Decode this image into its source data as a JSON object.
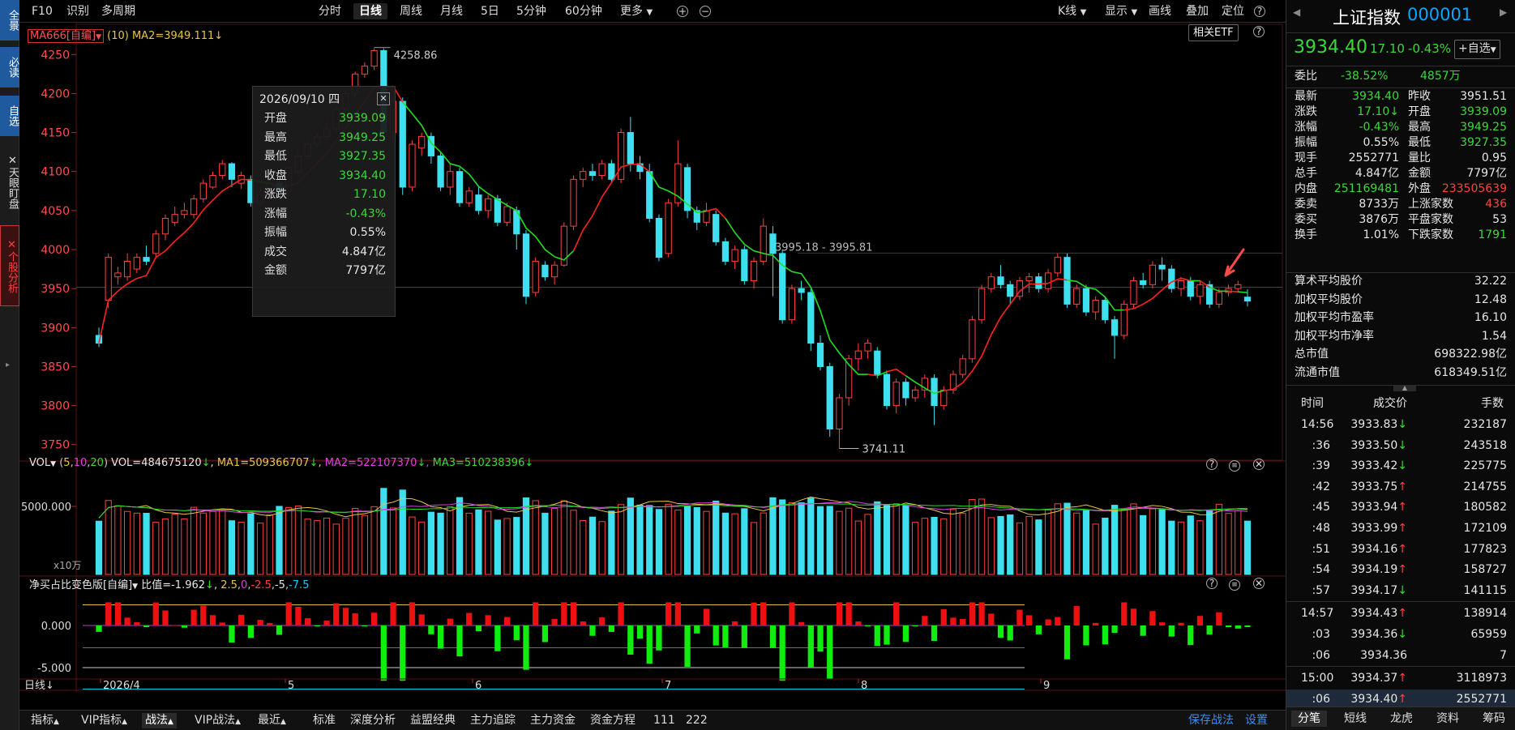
{
  "leftbar": {
    "items": [
      {
        "label": "全景",
        "style": "blue"
      },
      {
        "label": "必读",
        "style": "blue"
      },
      {
        "label": "自选",
        "style": "blue"
      },
      {
        "label": "天眼盯盘",
        "style": "plain"
      },
      {
        "label": "个股分析",
        "style": "red"
      }
    ]
  },
  "toolbar": {
    "left": [
      "F10",
      "识别",
      "多周期"
    ],
    "periods": [
      "分时",
      "日线",
      "周线",
      "月线",
      "5日",
      "5分钟",
      "60分钟",
      "更多"
    ],
    "active_period": "日线",
    "right": [
      "K线",
      "显示",
      "画线",
      "叠加",
      "定位"
    ],
    "etf_button": "相关ETF"
  },
  "indicator_main": {
    "name": "MA666[自编]",
    "param": "(10)",
    "ma2": "MA2=3949.111"
  },
  "price_axis": [
    "4250",
    "4200",
    "4150",
    "4100",
    "4050",
    "4000",
    "3950",
    "3900",
    "3850",
    "3800",
    "3750"
  ],
  "annotations": {
    "high": "4258.86",
    "low": "3741.11",
    "range": "3995.18 - 3995.81"
  },
  "tooltip": {
    "date": "2026/09/10 四",
    "rows": [
      {
        "k": "开盘",
        "v": "3939.09",
        "c": "green"
      },
      {
        "k": "最高",
        "v": "3949.25",
        "c": "green"
      },
      {
        "k": "最低",
        "v": "3927.35",
        "c": "green"
      },
      {
        "k": "收盘",
        "v": "3934.40",
        "c": "green"
      },
      {
        "k": "涨跌",
        "v": "17.10",
        "c": "green"
      },
      {
        "k": "涨幅",
        "v": "-0.43%",
        "c": "green"
      },
      {
        "k": "振幅",
        "v": "0.55%",
        "c": "white"
      },
      {
        "k": "成交",
        "v": "4.847亿",
        "c": "white"
      },
      {
        "k": "金额",
        "v": "7797亿",
        "c": "white"
      }
    ]
  },
  "vol_panel": {
    "label": "VOL",
    "params": "(5,10,20)",
    "vol": "VOL=484675120",
    "ma1": "MA1=509366707",
    "ma2": "MA2=522107370",
    "ma3": "MA3=510238396",
    "axis": "5000.000",
    "unit": "x10万"
  },
  "net_panel": {
    "label": "净买占比变色版[自编]",
    "ratio": "比值=-1.962",
    "levels": [
      "2.5",
      "0",
      "-2.5",
      "-5",
      "-7.5"
    ],
    "axis": [
      "0.000",
      "-5.000"
    ]
  },
  "date_axis": {
    "label": "日线",
    "labels": [
      "2026/4",
      "5",
      "6",
      "7",
      "8",
      "9"
    ]
  },
  "bottombar": {
    "items": [
      "指标",
      "VIP指标",
      "战法",
      "VIP战法",
      "最近",
      "标准",
      "深度分析",
      "益盟经典",
      "主力追踪",
      "主力资金",
      "资金方程",
      "111",
      "222"
    ],
    "active": "战法",
    "save": "保存战法",
    "settings": "设置"
  },
  "quote": {
    "name": "上证指数",
    "code": "000001",
    "price": "3934.40",
    "change": "17.10",
    "pct": "-0.43%",
    "add_button": "+自选",
    "weibi_label": "委比",
    "weibi": "-38.52%",
    "weicha": "4857万",
    "stats": [
      [
        "最新",
        "3934.40",
        "green",
        "昨收",
        "3951.51",
        "white"
      ],
      [
        "涨跌",
        "17.10↓",
        "green",
        "开盘",
        "3939.09",
        "green"
      ],
      [
        "涨幅",
        "-0.43%",
        "green",
        "最高",
        "3949.25",
        "green"
      ],
      [
        "振幅",
        "0.55%",
        "white",
        "最低",
        "3927.35",
        "green"
      ],
      [
        "现手",
        "2552771",
        "white",
        "量比",
        "0.95",
        "white"
      ],
      [
        "总手",
        "4.847亿",
        "white",
        "金额",
        "7797亿",
        "white"
      ],
      [
        "内盘",
        "251169481",
        "green",
        "外盘",
        "233505639",
        "red"
      ],
      [
        "委卖",
        "8733万",
        "white",
        "上涨家数",
        "436",
        "red"
      ],
      [
        "委买",
        "3876万",
        "white",
        "平盘家数",
        "53",
        "white"
      ],
      [
        "换手",
        "1.01%",
        "white",
        "下跌家数",
        "1791",
        "green"
      ]
    ],
    "avg": [
      [
        "算术平均股价",
        "32.22"
      ],
      [
        "加权平均股价",
        "12.48"
      ],
      [
        "加权平均市盈率",
        "16.10"
      ],
      [
        "加权平均市净率",
        "1.54"
      ],
      [
        "总市值",
        "698322.98亿"
      ],
      [
        "流通市值",
        "618349.51亿"
      ]
    ]
  },
  "ticks": {
    "headers": [
      "时间",
      "成交价",
      "手数"
    ],
    "rows": [
      [
        "14:56",
        "3933.83↓",
        "232187",
        "green"
      ],
      [
        ":36",
        "3933.50↓",
        "243518",
        "green"
      ],
      [
        ":39",
        "3933.42↓",
        "225775",
        "green"
      ],
      [
        ":42",
        "3933.75↑",
        "214755",
        "red"
      ],
      [
        ":45",
        "3933.94↑",
        "180582",
        "red"
      ],
      [
        ":48",
        "3933.99↑",
        "172109",
        "red"
      ],
      [
        ":51",
        "3934.16↑",
        "177823",
        "red"
      ],
      [
        ":54",
        "3934.19↑",
        "158727",
        "red"
      ],
      [
        ":57",
        "3934.17↓",
        "141115",
        "green"
      ],
      [
        "14:57",
        "3934.43↑",
        "138914",
        "red"
      ],
      [
        ":03",
        "3934.36↓",
        "65959",
        "green"
      ],
      [
        ":06",
        "3934.36",
        "7",
        "white"
      ],
      [
        "15:00",
        "3934.37↑",
        "3118973",
        "red"
      ],
      [
        ":06",
        "3934.40↑",
        "2552771",
        "red"
      ]
    ]
  },
  "rtabs": [
    "分笔",
    "短线",
    "龙虎",
    "资料",
    "筹码"
  ],
  "rtab_active": "分笔",
  "colors": {
    "up": "#ff4040",
    "down": "#3ee0f0",
    "ma_red": "#ff2020",
    "ma_green": "#22dd22"
  },
  "chart_data": {
    "type": "candlestick",
    "price_range": [
      3730,
      4270
    ],
    "dates": [
      "2026/4",
      "5",
      "6",
      "7",
      "8",
      "9"
    ],
    "candles": [
      [
        3890,
        3880,
        3900,
        3875
      ],
      [
        3935,
        3990,
        3995,
        3925
      ],
      [
        3965,
        3970,
        3978,
        3955
      ],
      [
        3965,
        3985,
        3995,
        3960
      ],
      [
        3975,
        3990,
        3995,
        3970
      ],
      [
        3990,
        3985,
        4005,
        3980
      ],
      [
        3995,
        4020,
        4025,
        3990
      ],
      [
        4020,
        4040,
        4045,
        4012
      ],
      [
        4035,
        4045,
        4055,
        4030
      ],
      [
        4045,
        4050,
        4060,
        4040
      ],
      [
        4045,
        4065,
        4070,
        4040
      ],
      [
        4065,
        4085,
        4090,
        4060
      ],
      [
        4080,
        4095,
        4100,
        4078
      ],
      [
        4095,
        4110,
        4115,
        4090
      ],
      [
        4110,
        4090,
        4112,
        4080
      ],
      [
        4085,
        4095,
        4100,
        4078
      ],
      [
        4090,
        4060,
        4095,
        4055
      ],
      [
        4060,
        4070,
        4080,
        4055
      ],
      [
        4070,
        4085,
        4090,
        4068
      ],
      [
        4085,
        4075,
        4090,
        4070
      ],
      [
        4075,
        4105,
        4108,
        4070
      ],
      [
        4100,
        4120,
        4125,
        4095
      ],
      [
        4120,
        4135,
        4140,
        4115
      ],
      [
        4135,
        4145,
        4150,
        4130
      ],
      [
        4145,
        4155,
        4165,
        4140
      ],
      [
        4155,
        4180,
        4185,
        4150
      ],
      [
        4180,
        4200,
        4205,
        4175
      ],
      [
        4200,
        4225,
        4228,
        4195
      ],
      [
        4225,
        4235,
        4240,
        4220
      ],
      [
        4235,
        4255,
        4258,
        4230
      ],
      [
        4255,
        4150,
        4258,
        4140
      ],
      [
        4150,
        4190,
        4195,
        4140
      ],
      [
        4190,
        4080,
        4195,
        4070
      ],
      [
        4080,
        4135,
        4140,
        4075
      ],
      [
        4130,
        4145,
        4150,
        4120
      ],
      [
        4145,
        4120,
        4150,
        4110
      ],
      [
        4120,
        4080,
        4125,
        4075
      ],
      [
        4080,
        4100,
        4110,
        4070
      ],
      [
        4100,
        4060,
        4105,
        4055
      ],
      [
        4060,
        4075,
        4080,
        4055
      ],
      [
        4070,
        4050,
        4080,
        4045
      ],
      [
        4050,
        4065,
        4070,
        4040
      ],
      [
        4065,
        4035,
        4070,
        4030
      ],
      [
        4035,
        4055,
        4060,
        4030
      ],
      [
        4050,
        4020,
        4055,
        4000
      ],
      [
        4020,
        3940,
        4025,
        3930
      ],
      [
        3945,
        3985,
        3990,
        3940
      ],
      [
        3980,
        3965,
        3985,
        3960
      ],
      [
        3965,
        3980,
        3985,
        3955
      ],
      [
        3980,
        4030,
        4035,
        3978
      ],
      [
        4030,
        4090,
        4095,
        4025
      ],
      [
        4090,
        4100,
        4105,
        4080
      ],
      [
        4100,
        4095,
        4110,
        4088
      ],
      [
        4095,
        4110,
        4115,
        4090
      ],
      [
        4110,
        4090,
        4115,
        4085
      ],
      [
        4090,
        4150,
        4155,
        4085
      ],
      [
        4150,
        4110,
        4170,
        4100
      ],
      [
        4110,
        4100,
        4120,
        4090
      ],
      [
        4100,
        4040,
        4110,
        4035
      ],
      [
        4040,
        3990,
        4045,
        3985
      ],
      [
        3995,
        4060,
        4065,
        3990
      ],
      [
        4060,
        4110,
        4140,
        4055
      ],
      [
        4105,
        4050,
        4110,
        4040
      ],
      [
        4050,
        4035,
        4055,
        4025
      ],
      [
        4035,
        4050,
        4060,
        4030
      ],
      [
        4045,
        4010,
        4050,
        4005
      ],
      [
        4010,
        3985,
        4015,
        3980
      ],
      [
        3985,
        4000,
        4005,
        3975
      ],
      [
        4000,
        3960,
        4005,
        3955
      ],
      [
        3960,
        3985,
        3990,
        3950
      ],
      [
        3985,
        4030,
        4040,
        3980
      ],
      [
        4020,
        3995,
        4030,
        3940
      ],
      [
        3995,
        3910,
        4000,
        3905
      ],
      [
        3910,
        3950,
        3955,
        3905
      ],
      [
        3950,
        3945,
        3960,
        3935
      ],
      [
        3945,
        3880,
        3950,
        3870
      ],
      [
        3880,
        3850,
        3890,
        3845
      ],
      [
        3850,
        3770,
        3855,
        3760
      ],
      [
        3770,
        3810,
        3815,
        3745
      ],
      [
        3810,
        3860,
        3865,
        3800
      ],
      [
        3860,
        3870,
        3880,
        3845
      ],
      [
        3870,
        3880,
        3885,
        3860
      ],
      [
        3870,
        3840,
        3875,
        3835
      ],
      [
        3840,
        3800,
        3845,
        3795
      ],
      [
        3800,
        3830,
        3835,
        3790
      ],
      [
        3830,
        3810,
        3835,
        3800
      ],
      [
        3810,
        3820,
        3825,
        3805
      ],
      [
        3820,
        3835,
        3840,
        3810
      ],
      [
        3835,
        3800,
        3840,
        3775
      ],
      [
        3800,
        3820,
        3825,
        3795
      ],
      [
        3820,
        3840,
        3845,
        3815
      ],
      [
        3840,
        3860,
        3865,
        3835
      ],
      [
        3860,
        3910,
        3915,
        3855
      ],
      [
        3910,
        3950,
        3955,
        3905
      ],
      [
        3950,
        3965,
        3970,
        3945
      ],
      [
        3965,
        3955,
        3980,
        3950
      ],
      [
        3955,
        3940,
        3960,
        3930
      ],
      [
        3940,
        3960,
        3965,
        3935
      ],
      [
        3960,
        3965,
        3970,
        3945
      ],
      [
        3965,
        3950,
        3970,
        3945
      ],
      [
        3950,
        3970,
        3975,
        3945
      ],
      [
        3970,
        3990,
        3995,
        3965
      ],
      [
        3990,
        3930,
        3995,
        3925
      ],
      [
        3930,
        3950,
        3955,
        3925
      ],
      [
        3950,
        3920,
        3955,
        3915
      ],
      [
        3920,
        3935,
        3940,
        3910
      ],
      [
        3935,
        3910,
        3940,
        3905
      ],
      [
        3910,
        3890,
        3915,
        3860
      ],
      [
        3890,
        3930,
        3935,
        3885
      ],
      [
        3930,
        3960,
        3965,
        3925
      ],
      [
        3960,
        3955,
        3970,
        3950
      ],
      [
        3955,
        3980,
        3985,
        3950
      ],
      [
        3980,
        3975,
        3990,
        3960
      ],
      [
        3975,
        3950,
        3980,
        3945
      ],
      [
        3950,
        3960,
        3965,
        3940
      ],
      [
        3960,
        3940,
        3965,
        3935
      ],
      [
        3940,
        3955,
        3960,
        3930
      ],
      [
        3955,
        3930,
        3960,
        3925
      ],
      [
        3930,
        3945,
        3950,
        3925
      ],
      [
        3945,
        3950,
        3955,
        3940
      ],
      [
        3950,
        3955,
        3960,
        3945
      ],
      [
        3939,
        3934,
        3949,
        3927
      ]
    ],
    "ma2_start": 3905,
    "ma2_end": 3949,
    "vol_axis": 5000,
    "net_axis": [
      0,
      -5
    ]
  }
}
